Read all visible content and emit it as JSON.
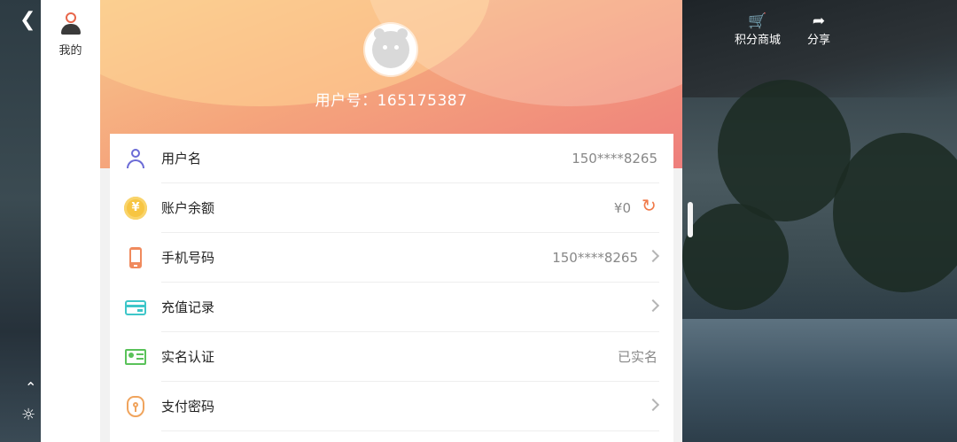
{
  "sidebar": {
    "mine_label": "我的"
  },
  "profile": {
    "user_id_text": "用户号：165175387"
  },
  "rows": [
    {
      "label": "用户名",
      "value": "150****8265"
    },
    {
      "label": "账户余额",
      "value": "¥0"
    },
    {
      "label": "手机号码",
      "value": "150****8265"
    },
    {
      "label": "充值记录",
      "value": ""
    },
    {
      "label": "实名认证",
      "value": "已实名"
    },
    {
      "label": "支付密码",
      "value": ""
    }
  ],
  "top_right": {
    "points_mall": "积分商城",
    "share": "分享"
  },
  "icons": {
    "back": "back-arrow-icon",
    "collapse": "chevron-up-icon",
    "settings": "brightness-icon",
    "cart": "cart-icon",
    "share": "share-icon"
  },
  "colors": {
    "accent": "#f07a4a",
    "header_start": "#f7c88c",
    "header_end": "#ee7e7c"
  }
}
